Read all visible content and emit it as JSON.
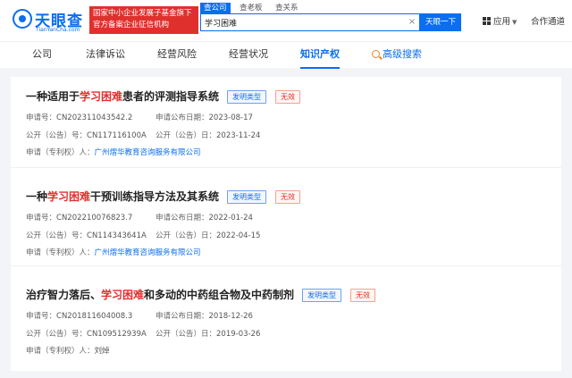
{
  "logo": {
    "name": "天眼查",
    "domain": "TianYanCha.com"
  },
  "badge": {
    "line1": "国家中小企业发展子基金旗下",
    "line2": "官方备案企业征信机构"
  },
  "search_tabs": [
    "查公司",
    "查老板",
    "查关系"
  ],
  "search": {
    "value": "学习困难",
    "button": "天眼一下"
  },
  "header_links": {
    "apps": "应用",
    "partner": "合作通道"
  },
  "nav": {
    "items": [
      "公司",
      "法律诉讼",
      "经营风险",
      "经营状况",
      "知识产权",
      "高级搜索"
    ],
    "active": "知识产权"
  },
  "labels": {
    "app_no": "申请号：",
    "app_date": "申请公布日期：",
    "pub_no": "公开（公告）号：",
    "pub_date": "公开（公告）日：",
    "applicant": "申请（专利权）人："
  },
  "results": [
    {
      "title_pre": "一种适用于",
      "title_hl": "学习困难",
      "title_post": "患者的评测指导系统",
      "type": "发明类型",
      "status": "无效",
      "app_no": "CN202311043542.2",
      "app_date": "2023-08-17",
      "pub_no": "CN117116100A",
      "pub_date": "2023-11-24",
      "applicant": "广州熠华教育咨询服务有限公司"
    },
    {
      "title_pre": "一种",
      "title_hl": "学习困难",
      "title_post": "干预训练指导方法及其系统",
      "type": "发明类型",
      "status": "无效",
      "app_no": "CN202210076823.7",
      "app_date": "2022-01-24",
      "pub_no": "CN114343641A",
      "pub_date": "2022-04-15",
      "applicant": "广州熠华教育咨询服务有限公司"
    },
    {
      "title_pre": "治疗智力落后、",
      "title_hl": "学习困难",
      "title_post": "和多动的中药组合物及中药制剂",
      "type": "发明类型",
      "status": "无效",
      "app_no": "CN201811604008.3",
      "app_date": "2018-12-26",
      "pub_no": "CN109512939A",
      "pub_date": "2019-03-26",
      "applicant": "刘焯"
    }
  ]
}
